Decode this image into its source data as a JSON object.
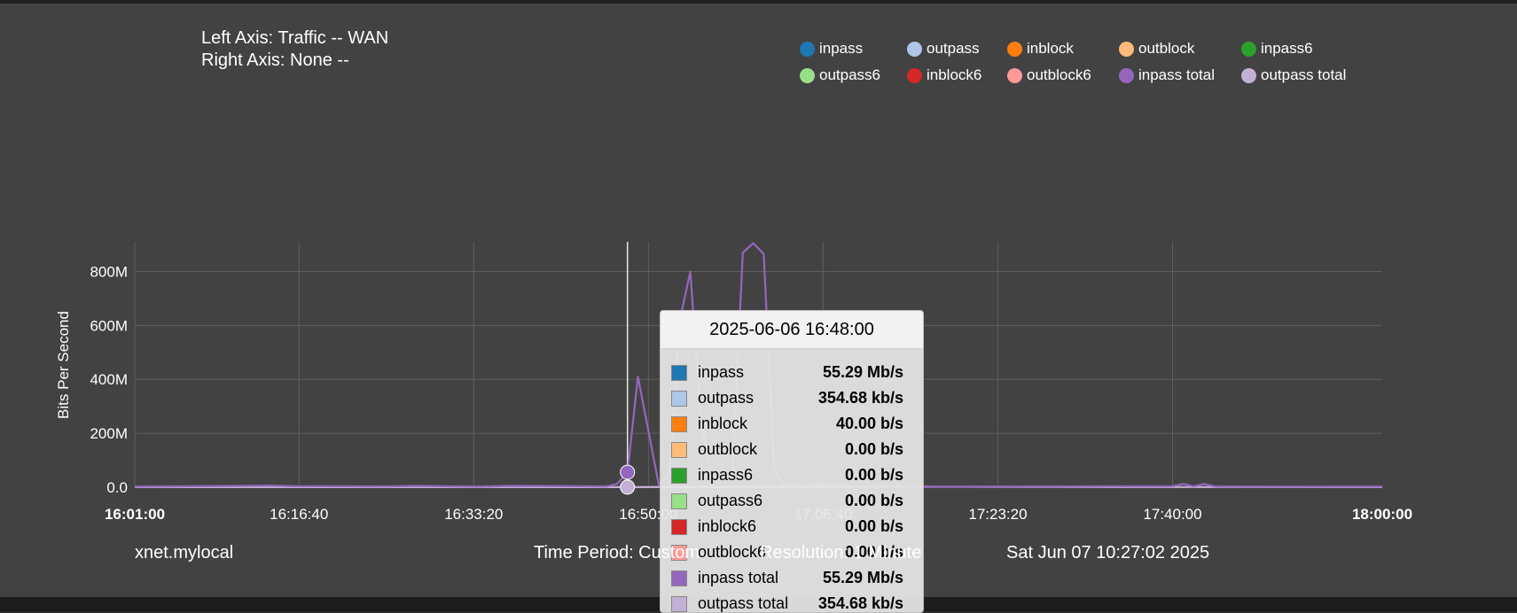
{
  "header": {
    "left_axis": "Left Axis: Traffic -- WAN",
    "right_axis": "Right Axis: None --"
  },
  "legend": [
    {
      "label": "inpass",
      "color": "#1f77b4"
    },
    {
      "label": "outpass",
      "color": "#aec7e8"
    },
    {
      "label": "inblock",
      "color": "#ff7f0e"
    },
    {
      "label": "outblock",
      "color": "#ffbb78"
    },
    {
      "label": "inpass6",
      "color": "#2ca02c"
    },
    {
      "label": "outpass6",
      "color": "#98df8a"
    },
    {
      "label": "inblock6",
      "color": "#d62728"
    },
    {
      "label": "outblock6",
      "color": "#ff9896"
    },
    {
      "label": "inpass total",
      "color": "#9467bd"
    },
    {
      "label": "outpass total",
      "color": "#c5b0d5"
    }
  ],
  "chart_data": {
    "type": "line",
    "ylabel": "Bits Per Second",
    "ylim": [
      0,
      910000000
    ],
    "xlim": [
      "16:01:00",
      "18:00:00"
    ],
    "y_ticks": [
      "0.0",
      "200M",
      "400M",
      "600M",
      "800M"
    ],
    "y_tick_values": [
      0,
      200000000,
      400000000,
      600000000,
      800000000
    ],
    "x_ticks": [
      "16:01:00",
      "16:16:40",
      "16:33:20",
      "16:50:00",
      "17:06:40",
      "17:23:20",
      "17:40:00",
      "18:00:00"
    ],
    "x_tick_bold": [
      true,
      false,
      false,
      false,
      false,
      false,
      false,
      true
    ],
    "hover_x": "16:48:00",
    "series": [
      {
        "name": "inpass total",
        "color": "#9467bd",
        "points": [
          [
            "16:01:00",
            2000000
          ],
          [
            "16:14:00",
            6000000
          ],
          [
            "16:16:00",
            4000000
          ],
          [
            "16:25:00",
            3000000
          ],
          [
            "16:28:00",
            5000000
          ],
          [
            "16:34:00",
            2000000
          ],
          [
            "16:37:00",
            5000000
          ],
          [
            "16:46:00",
            3000000
          ],
          [
            "16:47:00",
            12000000
          ],
          [
            "16:48:00",
            55290000
          ],
          [
            "16:49:00",
            410000000
          ],
          [
            "16:51:00",
            6000000
          ],
          [
            "16:52:00",
            50000000
          ],
          [
            "16:53:00",
            620000000
          ],
          [
            "16:54:00",
            800000000
          ],
          [
            "16:55:00",
            250000000
          ],
          [
            "16:56:00",
            40000000
          ],
          [
            "16:57:00",
            30000000
          ],
          [
            "16:58:00",
            50000000
          ],
          [
            "16:59:00",
            870000000
          ],
          [
            "17:00:00",
            905000000
          ],
          [
            "17:01:00",
            865000000
          ],
          [
            "17:02:00",
            60000000
          ],
          [
            "17:03:00",
            10000000
          ],
          [
            "17:05:00",
            5000000
          ],
          [
            "17:06:00",
            18000000
          ],
          [
            "17:07:00",
            8000000
          ],
          [
            "17:10:00",
            3000000
          ],
          [
            "17:20:00",
            2000000
          ],
          [
            "17:30:00",
            3000000
          ],
          [
            "17:40:00",
            4000000
          ],
          [
            "17:41:00",
            12000000
          ],
          [
            "17:42:00",
            3000000
          ],
          [
            "17:43:00",
            12000000
          ],
          [
            "17:44:00",
            3000000
          ],
          [
            "17:50:00",
            2000000
          ],
          [
            "18:00:00",
            2000000
          ]
        ]
      },
      {
        "name": "outpass total",
        "color": "#c5b0d5",
        "points": [
          [
            "16:01:00",
            300000
          ],
          [
            "16:48:00",
            354680
          ],
          [
            "17:06:00",
            2000000
          ],
          [
            "17:40:00",
            500000
          ],
          [
            "18:00:00",
            300000
          ]
        ]
      }
    ]
  },
  "tooltip": {
    "title": "2025-06-06 16:48:00",
    "rows": [
      {
        "key": "inpass",
        "value": "55.29 Mb/s",
        "color": "#1f77b4"
      },
      {
        "key": "outpass",
        "value": "354.68 kb/s",
        "color": "#aec7e8"
      },
      {
        "key": "inblock",
        "value": "40.00 b/s",
        "color": "#ff7f0e"
      },
      {
        "key": "outblock",
        "value": "0.00 b/s",
        "color": "#ffbb78"
      },
      {
        "key": "inpass6",
        "value": "0.00 b/s",
        "color": "#2ca02c"
      },
      {
        "key": "outpass6",
        "value": "0.00 b/s",
        "color": "#98df8a"
      },
      {
        "key": "inblock6",
        "value": "0.00 b/s",
        "color": "#d62728"
      },
      {
        "key": "outblock6",
        "value": "0.00 b/s",
        "color": "#ff9896"
      },
      {
        "key": "inpass total",
        "value": "55.29 Mb/s",
        "color": "#9467bd"
      },
      {
        "key": "outpass total",
        "value": "354.68 kb/s",
        "color": "#c5b0d5"
      }
    ]
  },
  "footer": {
    "host": "xnet.mylocal",
    "period": "Time Period: Custom",
    "resolution": "Resolution: 1 Minute",
    "timestamp": "Sat Jun 07 10:27:02 2025"
  }
}
